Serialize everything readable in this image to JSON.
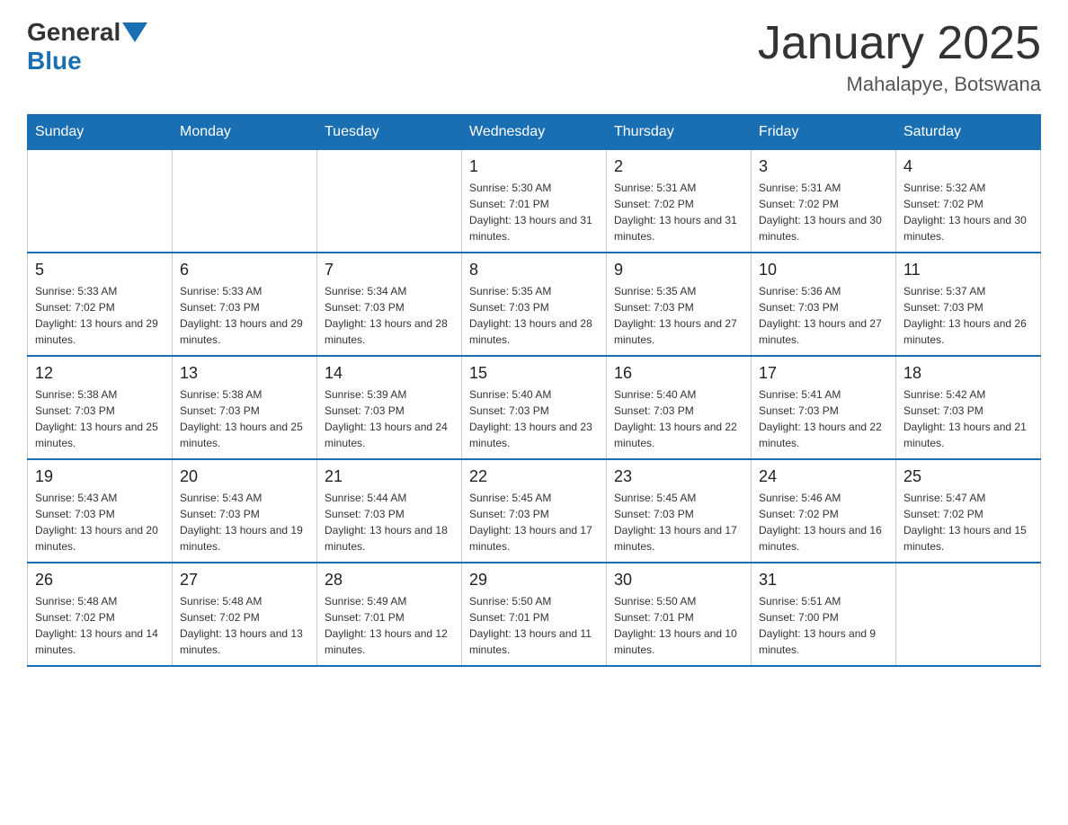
{
  "header": {
    "logo_general": "General",
    "logo_blue": "Blue",
    "title": "January 2025",
    "subtitle": "Mahalapye, Botswana"
  },
  "days_of_week": [
    "Sunday",
    "Monday",
    "Tuesday",
    "Wednesday",
    "Thursday",
    "Friday",
    "Saturday"
  ],
  "weeks": [
    [
      {
        "day": "",
        "info": ""
      },
      {
        "day": "",
        "info": ""
      },
      {
        "day": "",
        "info": ""
      },
      {
        "day": "1",
        "info": "Sunrise: 5:30 AM\nSunset: 7:01 PM\nDaylight: 13 hours and 31 minutes."
      },
      {
        "day": "2",
        "info": "Sunrise: 5:31 AM\nSunset: 7:02 PM\nDaylight: 13 hours and 31 minutes."
      },
      {
        "day": "3",
        "info": "Sunrise: 5:31 AM\nSunset: 7:02 PM\nDaylight: 13 hours and 30 minutes."
      },
      {
        "day": "4",
        "info": "Sunrise: 5:32 AM\nSunset: 7:02 PM\nDaylight: 13 hours and 30 minutes."
      }
    ],
    [
      {
        "day": "5",
        "info": "Sunrise: 5:33 AM\nSunset: 7:02 PM\nDaylight: 13 hours and 29 minutes."
      },
      {
        "day": "6",
        "info": "Sunrise: 5:33 AM\nSunset: 7:03 PM\nDaylight: 13 hours and 29 minutes."
      },
      {
        "day": "7",
        "info": "Sunrise: 5:34 AM\nSunset: 7:03 PM\nDaylight: 13 hours and 28 minutes."
      },
      {
        "day": "8",
        "info": "Sunrise: 5:35 AM\nSunset: 7:03 PM\nDaylight: 13 hours and 28 minutes."
      },
      {
        "day": "9",
        "info": "Sunrise: 5:35 AM\nSunset: 7:03 PM\nDaylight: 13 hours and 27 minutes."
      },
      {
        "day": "10",
        "info": "Sunrise: 5:36 AM\nSunset: 7:03 PM\nDaylight: 13 hours and 27 minutes."
      },
      {
        "day": "11",
        "info": "Sunrise: 5:37 AM\nSunset: 7:03 PM\nDaylight: 13 hours and 26 minutes."
      }
    ],
    [
      {
        "day": "12",
        "info": "Sunrise: 5:38 AM\nSunset: 7:03 PM\nDaylight: 13 hours and 25 minutes."
      },
      {
        "day": "13",
        "info": "Sunrise: 5:38 AM\nSunset: 7:03 PM\nDaylight: 13 hours and 25 minutes."
      },
      {
        "day": "14",
        "info": "Sunrise: 5:39 AM\nSunset: 7:03 PM\nDaylight: 13 hours and 24 minutes."
      },
      {
        "day": "15",
        "info": "Sunrise: 5:40 AM\nSunset: 7:03 PM\nDaylight: 13 hours and 23 minutes."
      },
      {
        "day": "16",
        "info": "Sunrise: 5:40 AM\nSunset: 7:03 PM\nDaylight: 13 hours and 22 minutes."
      },
      {
        "day": "17",
        "info": "Sunrise: 5:41 AM\nSunset: 7:03 PM\nDaylight: 13 hours and 22 minutes."
      },
      {
        "day": "18",
        "info": "Sunrise: 5:42 AM\nSunset: 7:03 PM\nDaylight: 13 hours and 21 minutes."
      }
    ],
    [
      {
        "day": "19",
        "info": "Sunrise: 5:43 AM\nSunset: 7:03 PM\nDaylight: 13 hours and 20 minutes."
      },
      {
        "day": "20",
        "info": "Sunrise: 5:43 AM\nSunset: 7:03 PM\nDaylight: 13 hours and 19 minutes."
      },
      {
        "day": "21",
        "info": "Sunrise: 5:44 AM\nSunset: 7:03 PM\nDaylight: 13 hours and 18 minutes."
      },
      {
        "day": "22",
        "info": "Sunrise: 5:45 AM\nSunset: 7:03 PM\nDaylight: 13 hours and 17 minutes."
      },
      {
        "day": "23",
        "info": "Sunrise: 5:45 AM\nSunset: 7:03 PM\nDaylight: 13 hours and 17 minutes."
      },
      {
        "day": "24",
        "info": "Sunrise: 5:46 AM\nSunset: 7:02 PM\nDaylight: 13 hours and 16 minutes."
      },
      {
        "day": "25",
        "info": "Sunrise: 5:47 AM\nSunset: 7:02 PM\nDaylight: 13 hours and 15 minutes."
      }
    ],
    [
      {
        "day": "26",
        "info": "Sunrise: 5:48 AM\nSunset: 7:02 PM\nDaylight: 13 hours and 14 minutes."
      },
      {
        "day": "27",
        "info": "Sunrise: 5:48 AM\nSunset: 7:02 PM\nDaylight: 13 hours and 13 minutes."
      },
      {
        "day": "28",
        "info": "Sunrise: 5:49 AM\nSunset: 7:01 PM\nDaylight: 13 hours and 12 minutes."
      },
      {
        "day": "29",
        "info": "Sunrise: 5:50 AM\nSunset: 7:01 PM\nDaylight: 13 hours and 11 minutes."
      },
      {
        "day": "30",
        "info": "Sunrise: 5:50 AM\nSunset: 7:01 PM\nDaylight: 13 hours and 10 minutes."
      },
      {
        "day": "31",
        "info": "Sunrise: 5:51 AM\nSunset: 7:00 PM\nDaylight: 13 hours and 9 minutes."
      },
      {
        "day": "",
        "info": ""
      }
    ]
  ],
  "colors": {
    "header_bg": "#1a6fb3",
    "header_text": "#ffffff",
    "border": "#1a6fb3",
    "cell_border": "#cccccc"
  }
}
